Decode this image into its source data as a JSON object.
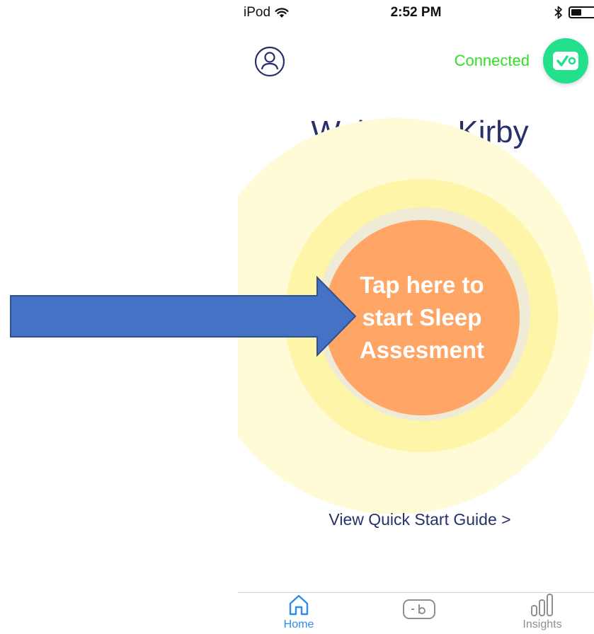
{
  "status_bar": {
    "carrier": "iPod",
    "time": "2:52 PM"
  },
  "header": {
    "connection_status": "Connected"
  },
  "main": {
    "welcome": "Welcome, Kirby",
    "start_button_label": "Tap here to start Sleep Assesment",
    "guide_link": "View Quick Start Guide >"
  },
  "tab_bar": {
    "tabs": [
      {
        "label": "Home",
        "icon": "home-icon",
        "active": true
      },
      {
        "label": "",
        "icon": "device-icon",
        "active": false
      },
      {
        "label": "Insights",
        "icon": "bar-chart-icon",
        "active": false
      }
    ]
  },
  "colors": {
    "accent": "#2fe029",
    "device_button": "#23e08c",
    "start_button": "#ffa566",
    "glow_outer": "#fffbd6",
    "glow_mid": "#fff5a8",
    "text_dark": "#27306a",
    "tab_active": "#2e8cf0",
    "tab_inactive": "#8e8e93",
    "annotation_arrow": "#4472c4"
  }
}
